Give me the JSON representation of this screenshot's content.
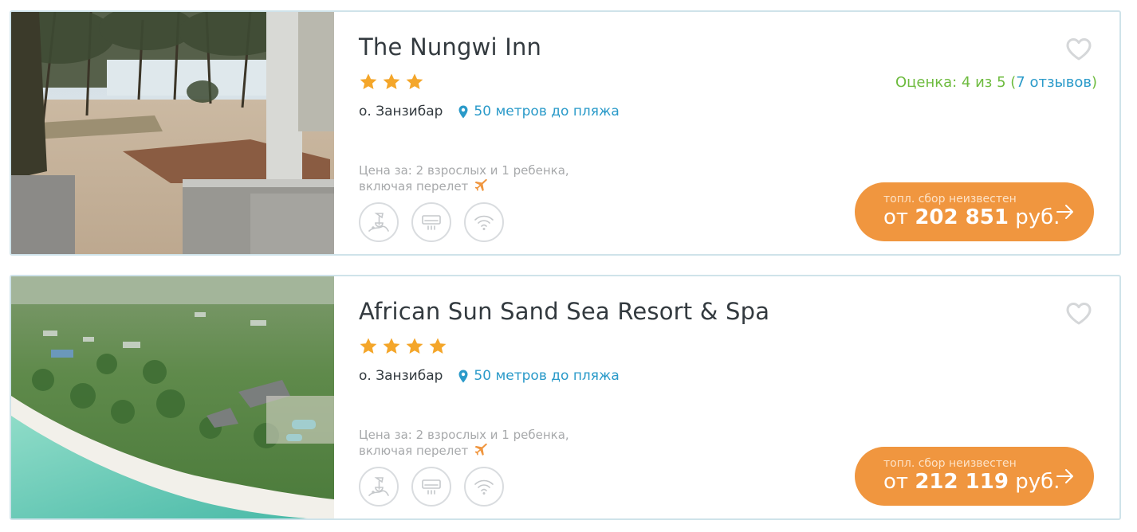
{
  "hotels": [
    {
      "name": "The Nungwi Inn",
      "stars": 3,
      "island": "о. Занзибар",
      "beach_distance": "50 метров до пляжа",
      "rating_prefix": "Оценка: ",
      "rating_value": "4",
      "rating_mid": " из 5 (",
      "rating_reviews": "7 отзывов",
      "rating_suffix": ")",
      "price_note_line1": "Цена за: 2 взрослых и 1 ребенка,",
      "price_note_line2": "включая перелет",
      "fee_note": "топл. сбор неизвестен",
      "price_prefix": "от ",
      "price_value": "202 851",
      "price_currency": " руб.",
      "amenities": [
        "beach-icon",
        "air-conditioner-icon",
        "wifi-icon"
      ]
    },
    {
      "name": "African Sun Sand Sea Resort & Spa",
      "stars": 4,
      "island": "о. Занзибар",
      "beach_distance": "50 метров до пляжа",
      "price_note_line1": "Цена за: 2 взрослых и 1 ребенка,",
      "price_note_line2": "включая перелет",
      "fee_note": "топл. сбор неизвестен",
      "price_prefix": "от ",
      "price_value": "212 119",
      "price_currency": " руб.",
      "amenities": [
        "beach-icon",
        "air-conditioner-icon",
        "wifi-icon"
      ]
    }
  ],
  "colors": {
    "accent_orange": "#f0963f",
    "link_blue": "#2a9ac9",
    "rating_green": "#6dbb3e",
    "star_gold": "#f4a62a",
    "card_border": "#cfe3ea"
  }
}
